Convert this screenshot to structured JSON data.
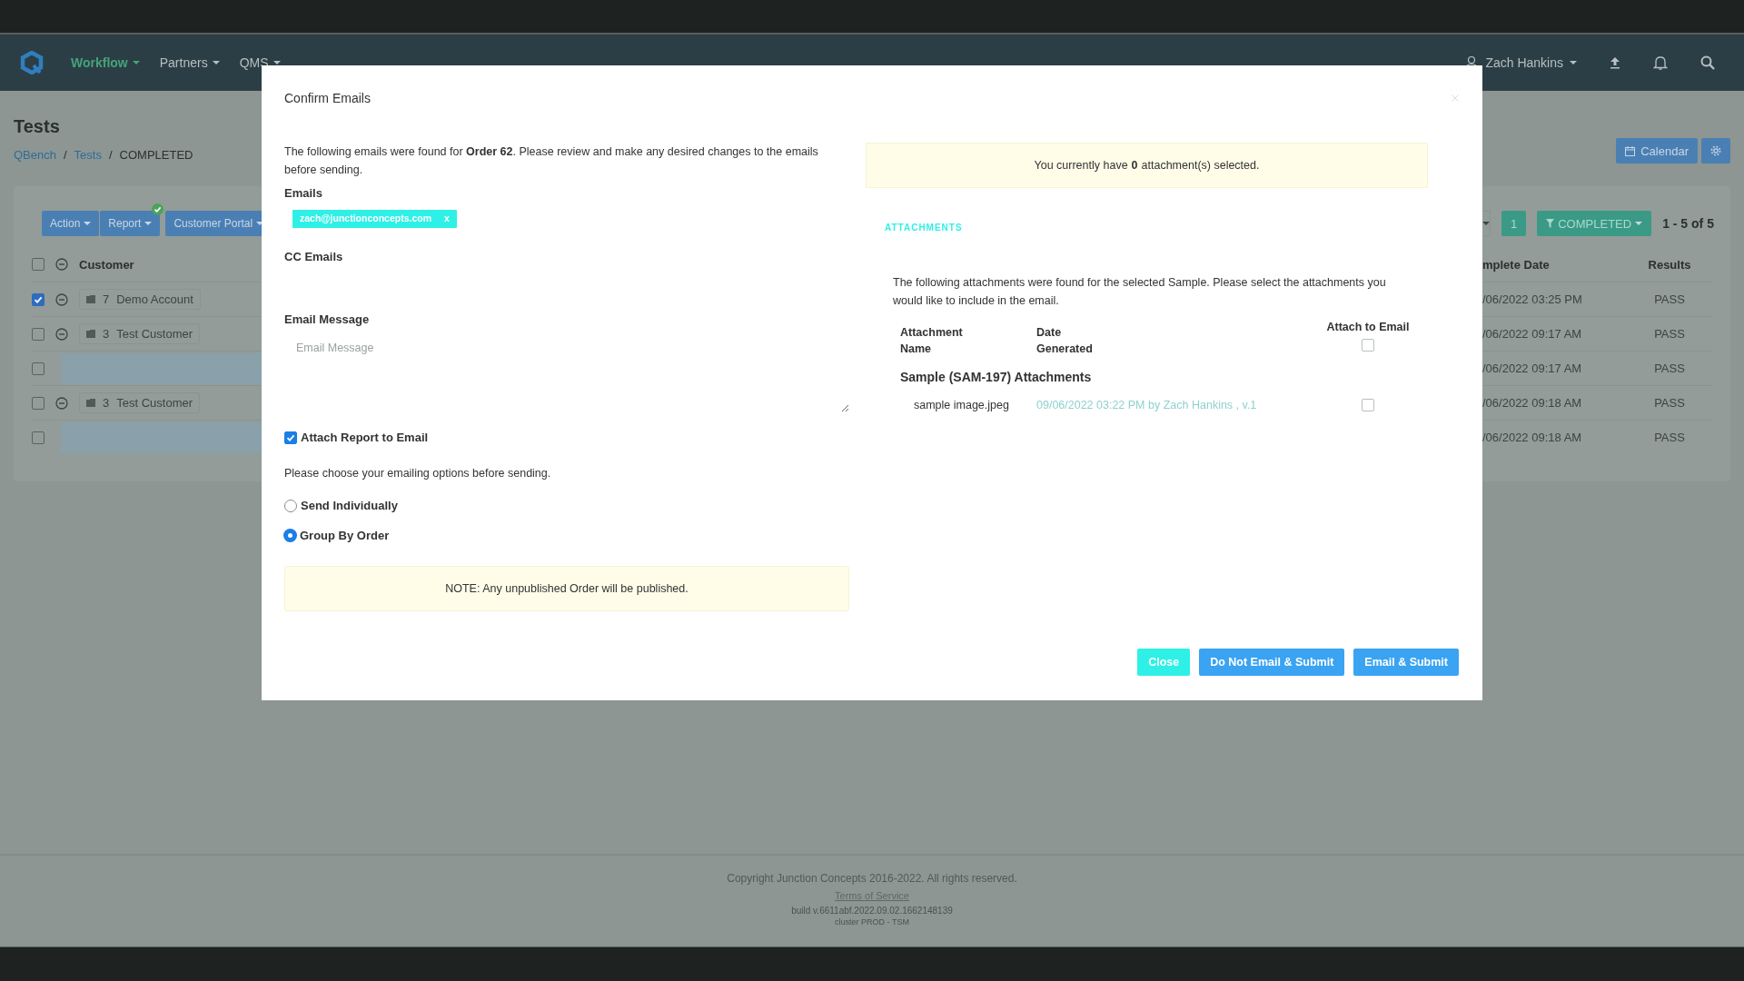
{
  "nav": {
    "items": [
      {
        "label": "Workflow",
        "selected": true
      },
      {
        "label": "Partners",
        "selected": false
      },
      {
        "label": "QMS",
        "selected": false
      }
    ],
    "user": "Zach Hankins"
  },
  "page": {
    "title": "Tests",
    "breadcrumb": [
      {
        "label": "QBench",
        "kind": "link"
      },
      {
        "label": "/",
        "kind": "separator"
      },
      {
        "label": "Tests",
        "kind": "link"
      },
      {
        "label": "/",
        "kind": "separator"
      },
      {
        "label": "COMPLETED",
        "kind": "current"
      }
    ],
    "toolbar": [
      "Action",
      "Report",
      "Customer Portal"
    ],
    "calendar": "Calendar",
    "page_button": "1",
    "filter": "COMPLETED",
    "range": "1 - 5 of 5"
  },
  "table": {
    "select_all": false,
    "customer_header": "Customer",
    "date_header": "mplete Date",
    "results_header": "Results",
    "rows": [
      {
        "kind": "customer",
        "checked": true,
        "count": "7",
        "customer": "Demo Account",
        "complete_date": "/06/2022 03:25 PM",
        "result": "PASS"
      },
      {
        "kind": "customer",
        "checked": false,
        "count": "3",
        "customer": "Test Customer",
        "complete_date": "/06/2022 09:17 AM",
        "result": "PASS"
      },
      {
        "kind": "blank",
        "checked": false,
        "complete_date": "/06/2022 09:17 AM",
        "result": "PASS"
      },
      {
        "kind": "customer",
        "checked": false,
        "count": "3",
        "customer": "Test Customer",
        "complete_date": "/06/2022 09:18 AM",
        "result": "PASS"
      },
      {
        "kind": "blank",
        "checked": false,
        "complete_date": "/06/2022 09:18 AM",
        "result": "PASS"
      }
    ]
  },
  "footer": {
    "copyright": "Copyright Junction Concepts 2016-2022. All rights reserved.",
    "terms": "Terms of Service",
    "build": "build v.6611abf.2022.09.02.1662148139",
    "cluster": "cluster PROD - TSM"
  },
  "modal": {
    "title": "Confirm Emails",
    "intro": "The following emails were found for **Order 62**. Please review and make any desired changes to the emails before sending.",
    "emails_label": "Emails",
    "emails": [
      {
        "address": "zach@junctionconcepts.com",
        "remove": "x"
      }
    ],
    "cc_label": "CC Emails",
    "message_label": "Email Message",
    "message_placeholder": "Email Message",
    "attach_report": {
      "label": "Attach Report to Email",
      "checked": true
    },
    "options_text": "Please choose your emailing options before sending.",
    "options": [
      {
        "label": "Send Individually",
        "selected": false
      },
      {
        "label": "Group By Order",
        "selected": true
      }
    ],
    "note": "NOTE: Any unpublished Order will be published.",
    "attachments_info": "You currently have **0** attachment(s) selected.",
    "attachments_tab": "ATTACHMENTS",
    "attachments_text": "The following attachments were found for the selected Sample. Please select the attachments you would like to include in the email.",
    "columns": [
      "Attachment Name",
      "Date Generated",
      "Attach to Email"
    ],
    "attach_all": false,
    "group": "Sample (SAM-197) Attachments",
    "files": [
      {
        "name": "sample image.jpeg",
        "generated": "09/06/2022 03:22 PM by Zach Hankins , v.1",
        "checked": false
      }
    ],
    "buttons": [
      {
        "label": "Close",
        "kind": "close"
      },
      {
        "label": "Do Not Email & Submit",
        "kind": "secondary"
      },
      {
        "label": "Email & Submit",
        "kind": "primary"
      }
    ]
  }
}
